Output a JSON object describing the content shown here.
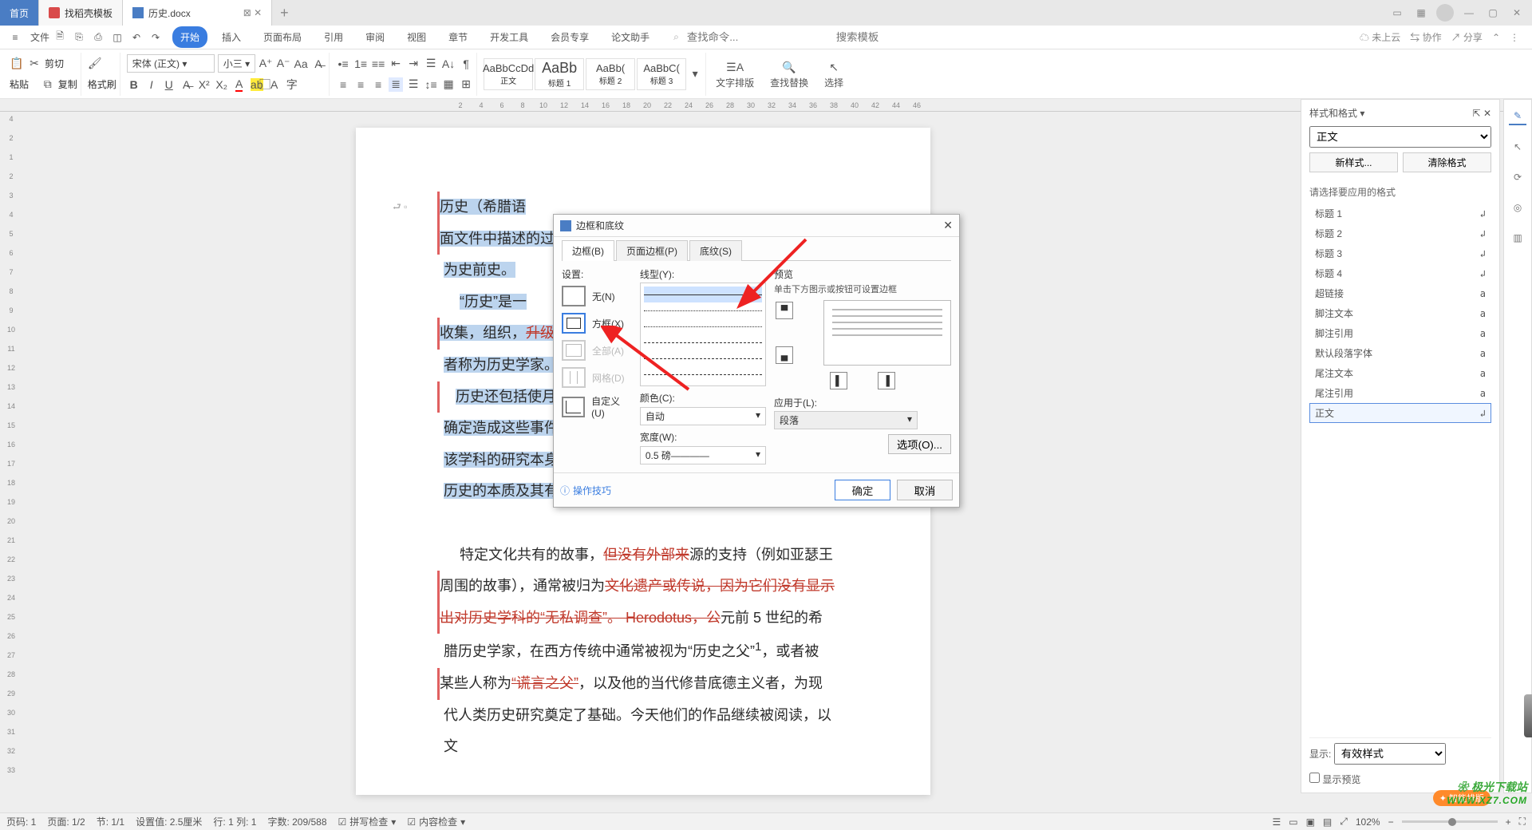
{
  "tabs": {
    "home": "首页",
    "templates": "找稻壳模板",
    "doc": "历史.docx",
    "add": "+"
  },
  "window_icons": {
    "grid": "☐",
    "apps": "⊞",
    "min": "—",
    "max": "▢",
    "close": "✕"
  },
  "menu": {
    "file": "文件",
    "tabs": [
      "开始",
      "插入",
      "页面布局",
      "引用",
      "审阅",
      "视图",
      "章节",
      "开发工具",
      "会员专享",
      "论文助手"
    ],
    "search_cmd_ph": "查找命令...",
    "search_tpl_ph": "搜索模板",
    "right": {
      "cloud": "未上云",
      "collab": "协作",
      "share": "分享"
    }
  },
  "toolbar": {
    "paste": "粘贴",
    "cut": "剪切",
    "copy": "复制",
    "format_painter": "格式刷",
    "font_name": "宋体 (正文)",
    "font_size": "小三",
    "styles": [
      {
        "p": "AaBbCcDd",
        "n": "正文"
      },
      {
        "p": "AaBb",
        "n": "标题 1"
      },
      {
        "p": "AaBb(",
        "n": "标题 2"
      },
      {
        "p": "AaBbC(",
        "n": "标题 3"
      }
    ],
    "paragraph_layout": "文字排版",
    "find_replace": "查找替换",
    "select": "选择"
  },
  "ruler_h": [
    "2",
    "4",
    "6",
    "8",
    "10",
    "12",
    "14",
    "16",
    "18",
    "20",
    "22",
    "24",
    "26",
    "28",
    "30",
    "32",
    "34",
    "36",
    "38",
    "40",
    "42",
    "44",
    "46"
  ],
  "ruler_v": [
    "4",
    "2",
    "1",
    "2",
    "3",
    "4",
    "5",
    "6",
    "7",
    "8",
    "9",
    "10",
    "11",
    "12",
    "13",
    "14",
    "15",
    "16",
    "17",
    "18",
    "19",
    "20",
    "21",
    "22",
    "23",
    "24",
    "25",
    "26",
    "27",
    "28",
    "29",
    "30",
    "31",
    "32",
    "33"
  ],
  "doc_text": {
    "p1a": "历史（希腊语",
    "p1b": "面文件中描述的过",
    "p1c": "为史前史。",
    "p2a": "“历史”是一",
    "p2b": "收集，组织，",
    "p2b_s": "升级",
    "p2c": "者称为历史学家。",
    "p3a": "历史还包括使月",
    "p3b": "确定造成这些事件",
    "p3c": "该学科的研究本身",
    "p3d": "历史的本质及其有",
    "p4a": "特定文化共有的故事，",
    "p4a_s": "但没有外部来",
    "p4b": "源的支持（例如亚瑟王",
    "p4c": "周围的故事），通常被归为",
    "p4c_s": "文化遗产或传说，因为它们没有显示",
    "p4d_s": "出对历史学科的“无私调查”。 Herodotus，公",
    "p4d": "元前 5 世纪的希",
    "p4e": "腊历史学家，在西方传统中通常被视为“历史之父”",
    "p4e_sup": "1",
    "p4e2": "，或者被",
    "p4f": "某些人称为",
    "p4f_s": "“谎言之父”",
    "p4g": "，以及他的当代修昔底德主义者，为现",
    "p4h": "代人类历史研究奠定了基础。今天他们的作品继续被阅读，以文"
  },
  "dialog": {
    "title": "边框和底纹",
    "tabs": [
      "边框(B)",
      "页面边框(P)",
      "底纹(S)"
    ],
    "settings_label": "设置:",
    "settings": [
      {
        "n": "无(N)"
      },
      {
        "n": "方框(X)"
      },
      {
        "n": "全部(A)"
      },
      {
        "n": "网格(D)"
      },
      {
        "n": "自定义(U)"
      }
    ],
    "line_label": "线型(Y):",
    "color_label": "颜色(C):",
    "color_value": "自动",
    "width_label": "宽度(W):",
    "width_value": "0.5  磅————",
    "preview_label": "预览",
    "preview_hint": "单击下方图示或按钮可设置边框",
    "apply_label": "应用于(L):",
    "apply_value": "段落",
    "options": "选项(O)...",
    "tips": "操作技巧",
    "ok": "确定",
    "cancel": "取消"
  },
  "styles_panel": {
    "title": "样式和格式",
    "dropdown": "▾",
    "pin": "📌",
    "close": "✕",
    "current": "正文",
    "new": "新样式...",
    "clear": "清除格式",
    "hint": "请选择要应用的格式",
    "items": [
      "标题 1",
      "标题 2",
      "标题 3",
      "标题 4",
      "超链接",
      "脚注文本",
      "脚注引用",
      "默认段落字体",
      "尾注文本",
      "尾注引用",
      "正文"
    ],
    "show_label": "显示:",
    "show_value": "有效样式",
    "preview_cb": "显示预览"
  },
  "status": {
    "page": "页码: 1",
    "pages": "页面: 1/2",
    "section": "节: 1/1",
    "ruler": "设置值: 2.5厘米",
    "line": "行: 1  列: 1",
    "words": "字数: 209/588",
    "spell": "拼写检查",
    "content": "内容检查",
    "smart": "智能排版",
    "zoom": "102%"
  },
  "watermark": {
    "t1": "❀ 极光下载站",
    "t2": "WWW.XZ7.COM"
  }
}
